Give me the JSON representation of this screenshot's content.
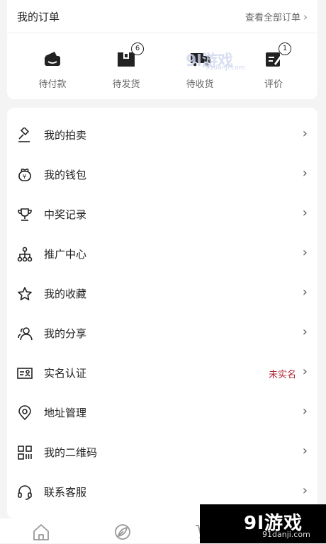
{
  "orders": {
    "title": "我的订单",
    "view_all": "查看全部订单",
    "items": [
      {
        "label": "待付款",
        "icon": "wallet-icon"
      },
      {
        "label": "待发货",
        "icon": "package-icon",
        "badge": "6"
      },
      {
        "label": "待收货",
        "icon": "truck-icon"
      },
      {
        "label": "评价",
        "icon": "review-icon",
        "badge": "1"
      }
    ]
  },
  "menu": [
    {
      "label": "我的拍卖",
      "icon": "auction-hammer-icon"
    },
    {
      "label": "我的钱包",
      "icon": "wallet-bag-icon"
    },
    {
      "label": "中奖记录",
      "icon": "trophy-icon"
    },
    {
      "label": "推广中心",
      "icon": "network-icon"
    },
    {
      "label": "我的收藏",
      "icon": "star-icon"
    },
    {
      "label": "我的分享",
      "icon": "users-icon"
    },
    {
      "label": "实名认证",
      "icon": "id-card-icon",
      "status": "未实名"
    },
    {
      "label": "地址管理",
      "icon": "location-pin-icon"
    },
    {
      "label": "我的二维码",
      "icon": "qr-code-icon"
    },
    {
      "label": "联系客服",
      "icon": "headset-icon"
    }
  ],
  "bottom_nav": [
    {
      "icon": "home-icon"
    },
    {
      "icon": "leaf-icon"
    },
    {
      "icon": "cart-icon"
    }
  ],
  "watermark": {
    "logo": "9l游戏",
    "url": "91danji.com",
    "small_logo": "9l游戏",
    "small_url": "91danji.com"
  },
  "colors": {
    "background": "#f4f4f4",
    "status_red": "#b0253a"
  }
}
